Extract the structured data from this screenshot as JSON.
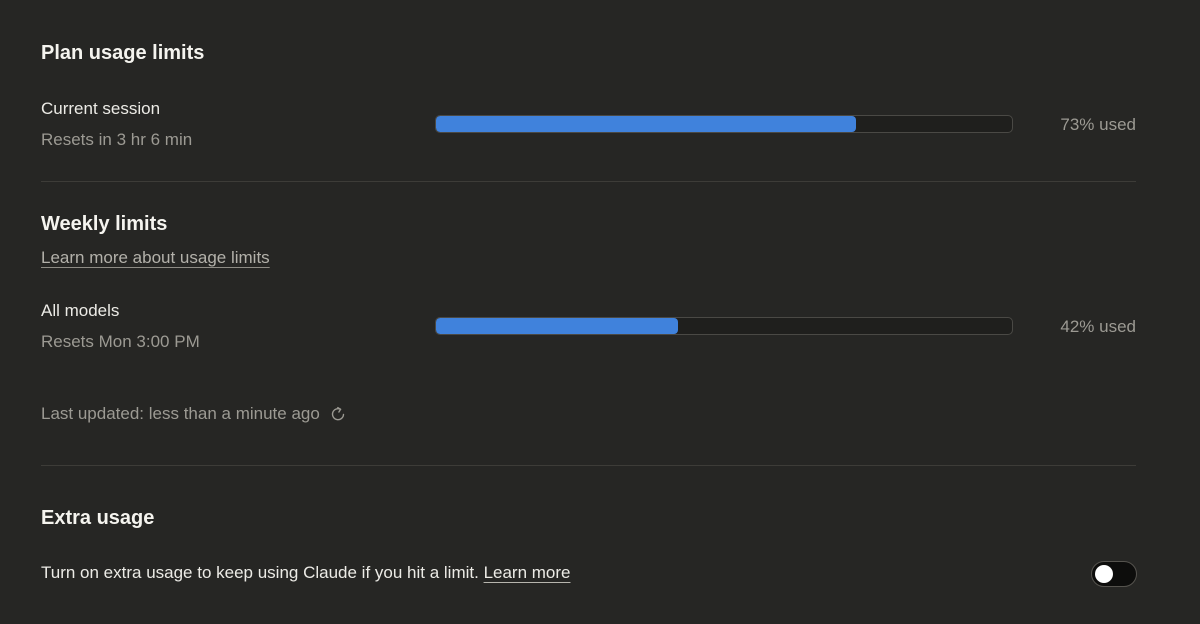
{
  "plan": {
    "title": "Plan usage limits",
    "session": {
      "label": "Current session",
      "reset": "Resets in 3 hr 6 min",
      "used_percent": 73,
      "used_text": "73% used"
    }
  },
  "weekly": {
    "title": "Weekly limits",
    "learn_link": "Learn more about usage limits",
    "all_models": {
      "label": "All models",
      "reset": "Resets Mon 3:00 PM",
      "used_percent": 42,
      "used_text": "42% used"
    },
    "last_updated": "Last updated: less than a minute ago",
    "refresh_icon": "refresh-icon"
  },
  "extra": {
    "title": "Extra usage",
    "description": "Turn on extra usage to keep using Claude if you hit a limit.",
    "learn_more": "Learn more",
    "toggle_on": false
  },
  "colors": {
    "background": "#262624",
    "progress_fill": "#4082dc",
    "progress_track": "#1f1f1d"
  }
}
